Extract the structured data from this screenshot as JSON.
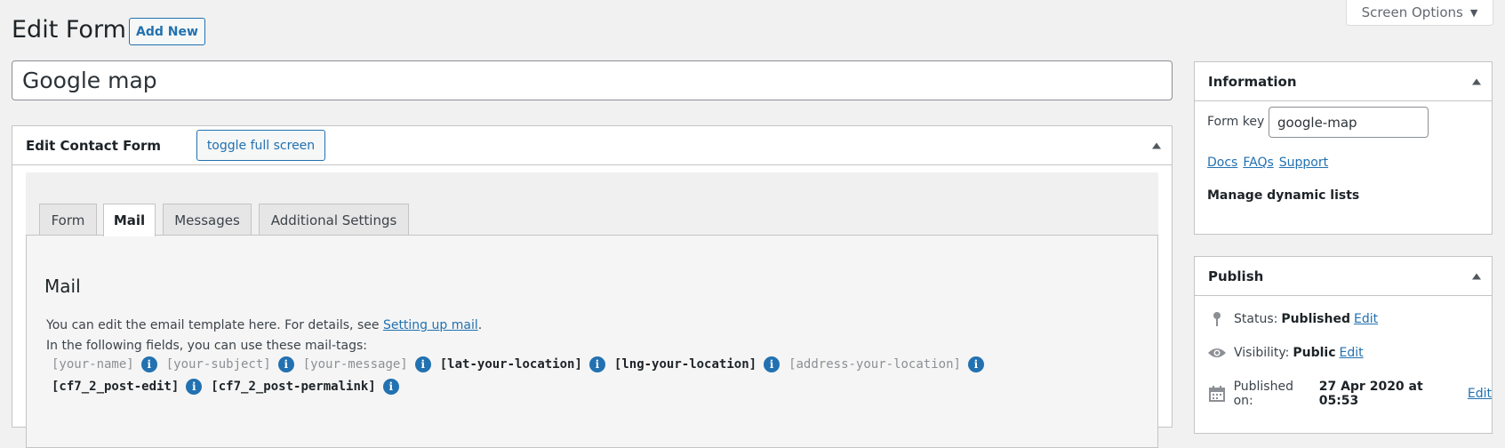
{
  "header": {
    "screen_options": "Screen Options",
    "title": "Edit Form",
    "add_new": "Add New"
  },
  "form_title": "Google map",
  "editor": {
    "heading": "Edit Contact Form",
    "toggle_fullscreen": "toggle full screen",
    "tabs": [
      {
        "label": "Form",
        "active": false
      },
      {
        "label": "Mail",
        "active": true
      },
      {
        "label": "Messages",
        "active": false
      },
      {
        "label": "Additional Settings",
        "active": false
      }
    ],
    "panel": {
      "title": "Mail",
      "desc1_prefix": "You can edit the email template here. For details, see ",
      "desc1_link": "Setting up mail",
      "desc1_suffix": ".",
      "desc2": "In the following fields, you can use these mail-tags:",
      "tags_line1": [
        "[your-name]",
        "[your-subject]",
        "[your-message]",
        "[lat-your-location]",
        "[lng-your-location]",
        "[address-your-location]"
      ],
      "tags_line2": [
        "[cf7_2_post-edit]",
        "[cf7_2_post-permalink]"
      ]
    }
  },
  "information": {
    "heading": "Information",
    "form_key_label": "Form key",
    "form_key_value": "google-map",
    "links": [
      "Docs",
      "FAQs",
      "Support"
    ],
    "manage_lists": "Manage dynamic lists"
  },
  "publish": {
    "heading": "Publish",
    "status_label": "Status:",
    "status_value": "Published",
    "visibility_label": "Visibility:",
    "visibility_value": "Public",
    "published_label": "Published on:",
    "published_value": "27 Apr 2020 at 05:53",
    "edit_label": "Edit"
  },
  "colors": {
    "accent": "#2271b1",
    "background": "#f1f1f1"
  }
}
